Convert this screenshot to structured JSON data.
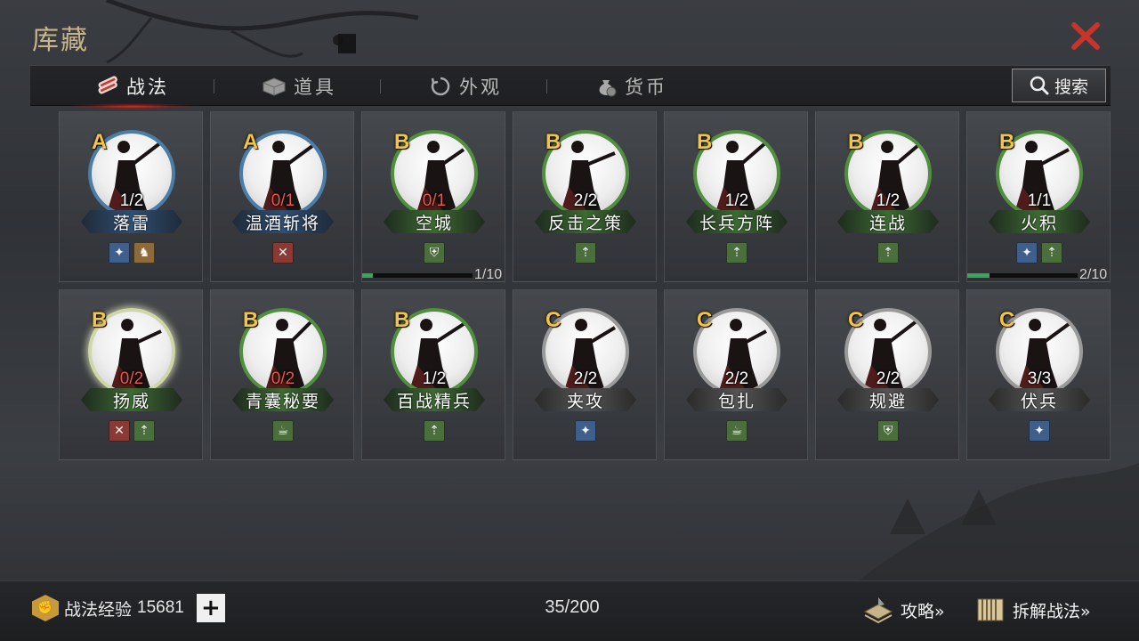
{
  "page": {
    "title": "库藏",
    "close_icon": "close-x-icon"
  },
  "tabs": [
    {
      "label": "战法",
      "icon": "scroll-bundle-icon",
      "active": true
    },
    {
      "label": "道具",
      "icon": "box-icon",
      "active": false
    },
    {
      "label": "外观",
      "icon": "swirl-icon",
      "active": false
    },
    {
      "label": "货币",
      "icon": "coin-bag-icon",
      "active": false
    }
  ],
  "search": {
    "label": "搜索",
    "icon": "magnifier-icon"
  },
  "cards": [
    {
      "grade": "A",
      "count": "1/2",
      "name": "落雷",
      "tier": "blue",
      "count_red": false,
      "traits": [
        {
          "icon": "blue",
          "glyph": "✦"
        },
        {
          "icon": "orange",
          "glyph": "♞"
        }
      ]
    },
    {
      "grade": "A",
      "count": "0/1",
      "name": "温酒斩将",
      "tier": "blue",
      "count_red": true,
      "traits": [
        {
          "icon": "red",
          "glyph": "✕"
        }
      ]
    },
    {
      "grade": "B",
      "count": "0/1",
      "name": "空城",
      "tier": "green",
      "count_red": true,
      "traits": [
        {
          "icon": "green",
          "glyph": "⛨"
        }
      ],
      "progress": {
        "value": 0.1,
        "text": "1/10"
      }
    },
    {
      "grade": "B",
      "count": "2/2",
      "name": "反击之策",
      "tier": "green",
      "count_red": false,
      "traits": [
        {
          "icon": "green",
          "glyph": "⇡"
        }
      ]
    },
    {
      "grade": "B",
      "count": "1/2",
      "name": "长兵方阵",
      "tier": "green",
      "count_red": false,
      "traits": [
        {
          "icon": "green",
          "glyph": "⇡"
        }
      ]
    },
    {
      "grade": "B",
      "count": "1/2",
      "name": "连战",
      "tier": "green",
      "count_red": false,
      "traits": [
        {
          "icon": "green",
          "glyph": "⇡"
        }
      ]
    },
    {
      "grade": "B",
      "count": "1/1",
      "name": "火积",
      "tier": "green",
      "count_red": false,
      "traits": [
        {
          "icon": "blue",
          "glyph": "✦"
        },
        {
          "icon": "green",
          "glyph": "⇡"
        }
      ],
      "progress": {
        "value": 0.2,
        "text": "2/10"
      }
    },
    {
      "grade": "B",
      "count": "0/2",
      "name": "扬威",
      "tier": "glow",
      "count_red": true,
      "traits": [
        {
          "icon": "red",
          "glyph": "✕"
        },
        {
          "icon": "green",
          "glyph": "⇡"
        }
      ]
    },
    {
      "grade": "B",
      "count": "0/2",
      "name": "青囊秘要",
      "tier": "green",
      "count_red": true,
      "traits": [
        {
          "icon": "green",
          "glyph": "☕"
        }
      ]
    },
    {
      "grade": "B",
      "count": "1/2",
      "name": "百战精兵",
      "tier": "green",
      "count_red": false,
      "traits": [
        {
          "icon": "green",
          "glyph": "⇡"
        }
      ]
    },
    {
      "grade": "C",
      "count": "2/2",
      "name": "夹攻",
      "tier": "gray",
      "count_red": false,
      "traits": [
        {
          "icon": "blue",
          "glyph": "✦"
        }
      ]
    },
    {
      "grade": "C",
      "count": "2/2",
      "name": "包扎",
      "tier": "gray",
      "count_red": false,
      "traits": [
        {
          "icon": "green",
          "glyph": "☕"
        }
      ]
    },
    {
      "grade": "C",
      "count": "2/2",
      "name": "规避",
      "tier": "gray",
      "count_red": false,
      "traits": [
        {
          "icon": "green",
          "glyph": "⛨"
        }
      ]
    },
    {
      "grade": "C",
      "count": "3/3",
      "name": "伏兵",
      "tier": "gray",
      "count_red": false,
      "traits": [
        {
          "icon": "blue",
          "glyph": "✦"
        }
      ]
    }
  ],
  "footer": {
    "exp_label": "战法经验",
    "exp_value": "15681",
    "plus_label": "+",
    "capacity": "35/200",
    "guide_label": "攻略»",
    "dismantle_label": "拆解战法»"
  }
}
